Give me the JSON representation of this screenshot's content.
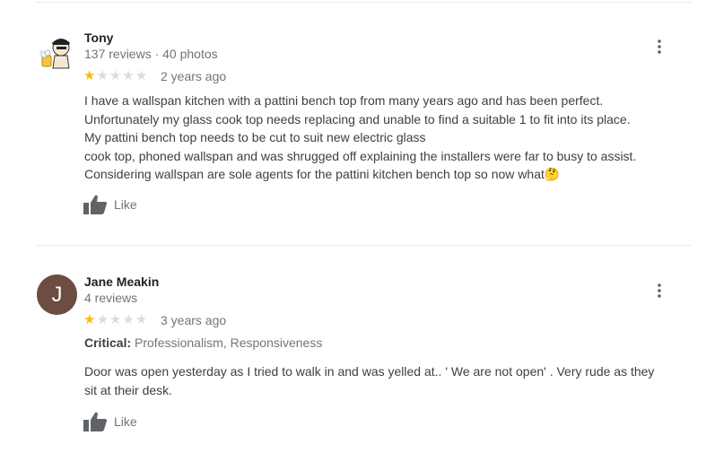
{
  "reviews": [
    {
      "author": "Tony",
      "meta": "137 reviews · 40 photos",
      "rating": 1,
      "date": "2 years ago",
      "text": "I have a wallspan kitchen with a pattini bench top from many years ago and has been perfect.\nUnfortunately my glass cook top needs replacing and unable to find a suitable 1 to fit into its place.\nMy pattini bench top needs to be cut to suit new electric glass\ncook top, phoned wallspan and was shrugged off explaining the installers were far to busy to assist.\nConsidering wallspan are sole agents for the pattini kitchen bench top so now what🤔",
      "like_label": "Like"
    },
    {
      "author": "Jane Meakin",
      "avatar_letter": "J",
      "meta": "4 reviews",
      "rating": 1,
      "date": "3 years ago",
      "critical_label": "Critical:",
      "critical_value": "Professionalism, Responsiveness",
      "text": "Door was open yesterday as I tried to walk in and was yelled at.. ' We are not open' . Very rude as they\nsit at their desk.",
      "like_label": "Like"
    }
  ],
  "colors": {
    "star_on": "#fbbc04",
    "star_off": "#dadce0",
    "icon": "#5f6368",
    "avatar_bg": "#6d4c41"
  }
}
